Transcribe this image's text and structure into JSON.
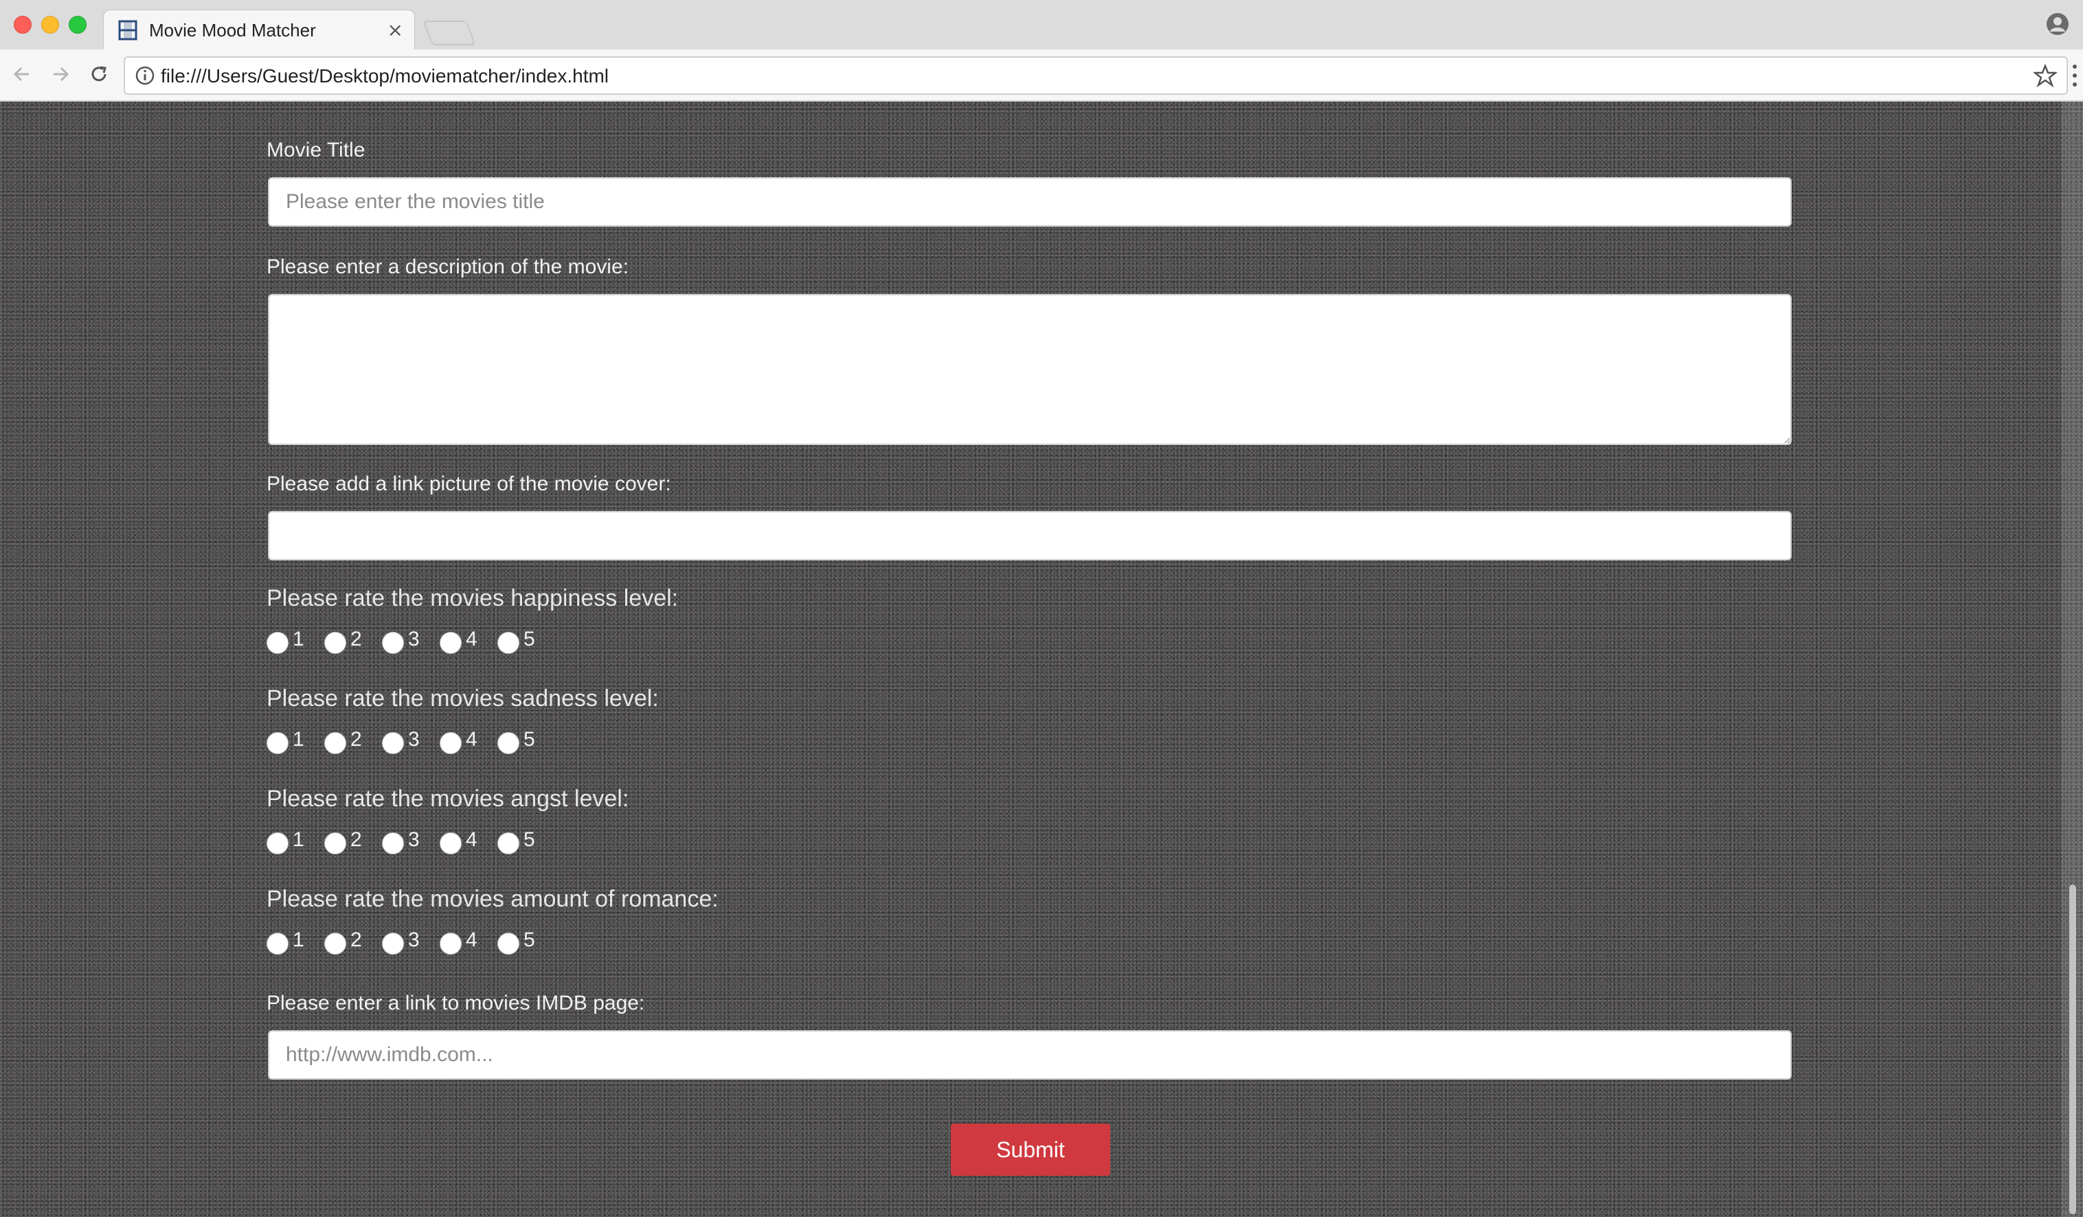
{
  "browser": {
    "tab_title": "Movie Mood Matcher",
    "tab_close": "×",
    "url": "file:///Users/Guest/Desktop/moviematcher/index.html"
  },
  "form": {
    "title_label": "Movie Title",
    "title_placeholder": "Please enter the movies title",
    "description_label": "Please enter a description of the movie:",
    "cover_label": "Please add a link picture of the movie cover:",
    "ratings": [
      {
        "label": "Please rate the movies happiness level:",
        "options": [
          "1",
          "2",
          "3",
          "4",
          "5"
        ]
      },
      {
        "label": "Please rate the movies sadness level:",
        "options": [
          "1",
          "2",
          "3",
          "4",
          "5"
        ]
      },
      {
        "label": "Please rate the movies angst level:",
        "options": [
          "1",
          "2",
          "3",
          "4",
          "5"
        ]
      },
      {
        "label": "Please rate the movies amount of romance:",
        "options": [
          "1",
          "2",
          "3",
          "4",
          "5"
        ]
      }
    ],
    "imdb_label": "Please enter a link to movies IMDB page:",
    "imdb_placeholder": "http://www.imdb.com...",
    "submit_label": "Submit"
  },
  "colors": {
    "submit_bg": "#d0393f",
    "background": "#4b4b4b"
  }
}
